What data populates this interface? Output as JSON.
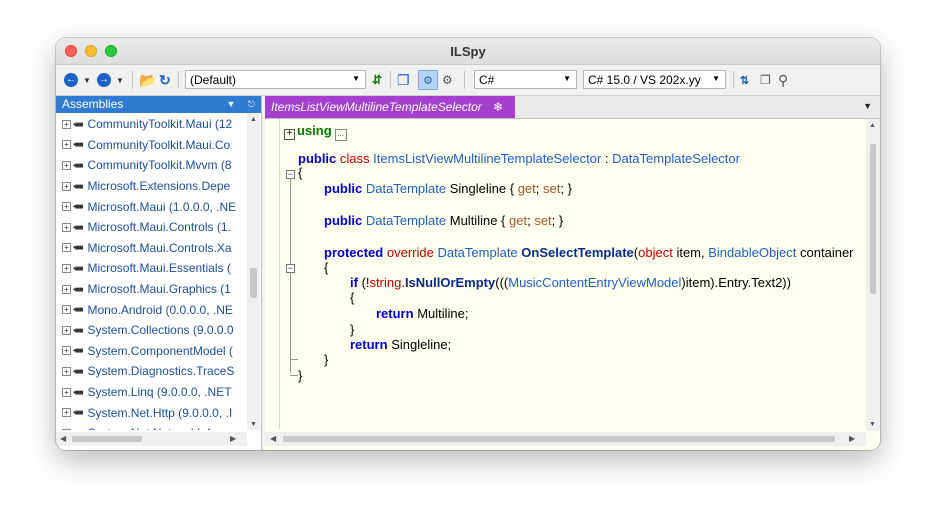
{
  "window": {
    "title": "ILSpy"
  },
  "toolbar": {
    "back_icon": "back-arrow-icon",
    "forward_icon": "forward-arrow-icon",
    "assembly_list": "(Default)",
    "language": "C#",
    "language_version": "C# 15.0 / VS 202x.yy"
  },
  "assemblies": {
    "header": "Assemblies",
    "items": [
      "CommunityToolkit.Maui (12",
      "CommunityToolkit.Maui.Co",
      "CommunityToolkit.Mvvm (8",
      "Microsoft.Extensions.Depe",
      "Microsoft.Maui (1.0.0.0, .NE",
      "Microsoft.Maui.Controls (1.",
      "Microsoft.Maui.Controls.Xa",
      "Microsoft.Maui.Essentials (",
      "Microsoft.Maui.Graphics (1",
      "Mono.Android (0.0.0.0, .NE",
      "System.Collections (9.0.0.0",
      "System.ComponentModel (",
      "System.Diagnostics.TraceS",
      "System.Linq (9.0.0.0, .NET",
      "System.Net.Http (9.0.0.0, .I",
      "System.Net.NetworkInform"
    ]
  },
  "tab": {
    "title": "ItemsListViewMultilineTemplateSelector"
  },
  "code": {
    "using_kw": "using",
    "using_ellipsis": "...",
    "public": "public",
    "class": "class",
    "class_name": "ItemsListViewMultilineTemplateSelector",
    "colon": " : ",
    "base_class": "DataTemplateSelector",
    "open_brace": "{",
    "close_brace": "}",
    "data_template": "DataTemplate",
    "prop1_name": "Singleline",
    "prop2_name": "Multiline",
    "get": "get",
    "set": "set",
    "protected": "protected",
    "override": "override",
    "method_name": "OnSelectTemplate",
    "object_kw": "object",
    "param_item": "item",
    "bindable_object": "BindableObject",
    "param_container": "container",
    "if_kw": "if",
    "string_kw": "string",
    "is_null_or_empty": "IsNullOrEmpty",
    "vm_type": "MusicContentEntryViewModel",
    "cast_tail": "item).Entry.Text2))",
    "return_kw": "return",
    "return_multi": "Multiline;",
    "return_single": "Singleline;"
  },
  "colors": {
    "accent": "#2f7bd1",
    "tab": "#a43fcf",
    "editor_bg": "#fffff0"
  }
}
